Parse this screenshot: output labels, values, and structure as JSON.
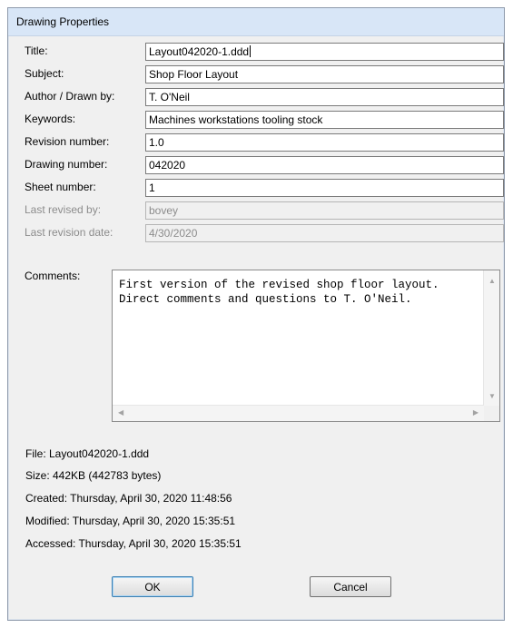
{
  "window": {
    "title": "Drawing Properties"
  },
  "fields": [
    {
      "label": "Title:",
      "value": "Layout042020-1.ddd",
      "disabled": false
    },
    {
      "label": "Subject:",
      "value": "Shop Floor Layout",
      "disabled": false
    },
    {
      "label": "Author / Drawn by:",
      "value": "T. O'Neil",
      "disabled": false
    },
    {
      "label": "Keywords:",
      "value": "Machines workstations tooling stock",
      "disabled": false
    },
    {
      "label": "Revision number:",
      "value": "1.0",
      "disabled": false
    },
    {
      "label": "Drawing number:",
      "value": "042020",
      "disabled": false
    },
    {
      "label": "Sheet number:",
      "value": "1",
      "disabled": false
    },
    {
      "label": "Last revised by:",
      "value": "bovey",
      "disabled": true
    },
    {
      "label": "Last revision date:",
      "value": "4/30/2020",
      "disabled": true
    }
  ],
  "comments": {
    "label": "Comments:",
    "text": "First version of the revised shop floor layout.\nDirect comments and questions to T. O'Neil."
  },
  "file_info": {
    "file": "File: Layout042020-1.ddd",
    "size": "Size: 442KB (442783 bytes)",
    "created": "Created: Thursday, April 30, 2020 11:48:56",
    "modified": "Modified: Thursday, April 30, 2020 15:35:51",
    "accessed": "Accessed: Thursday, April 30, 2020 15:35:51"
  },
  "buttons": {
    "ok": "OK",
    "cancel": "Cancel"
  }
}
